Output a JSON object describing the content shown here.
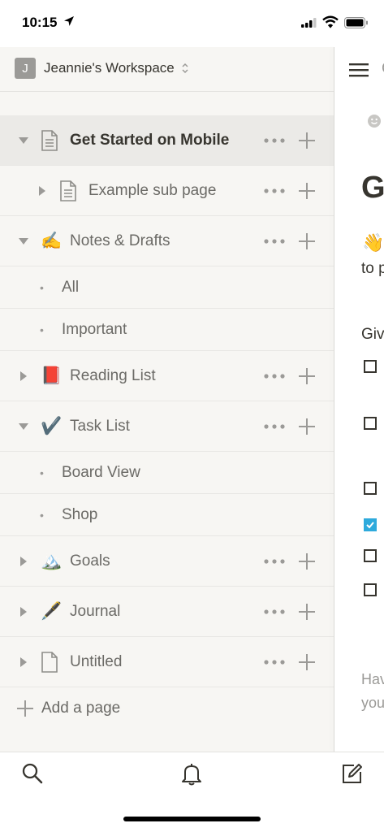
{
  "status_bar": {
    "time": "10:15"
  },
  "workspace": {
    "avatar_letter": "J",
    "name": "Jeannie's Workspace"
  },
  "pages": [
    {
      "type": "page",
      "toggle": "expanded",
      "icon": "page-icon",
      "label": "Get Started on Mobile",
      "active": true
    },
    {
      "type": "subpage",
      "toggle": "collapsed",
      "icon": "page-icon",
      "label": "Example sub page"
    },
    {
      "type": "page",
      "toggle": "expanded",
      "icon": "✍️",
      "label": "Notes & Drafts"
    },
    {
      "type": "view",
      "label": "All"
    },
    {
      "type": "view",
      "label": "Important"
    },
    {
      "type": "page",
      "toggle": "collapsed",
      "icon": "📕",
      "label": "Reading List"
    },
    {
      "type": "page",
      "toggle": "expanded",
      "icon": "✔️",
      "label": "Task List"
    },
    {
      "type": "view",
      "label": "Board View"
    },
    {
      "type": "view",
      "label": "Shop"
    },
    {
      "type": "page",
      "toggle": "collapsed",
      "icon": "🏔️",
      "label": "Goals"
    },
    {
      "type": "page",
      "toggle": "collapsed",
      "icon": "🖋️",
      "label": "Journal"
    },
    {
      "type": "page",
      "toggle": "collapsed",
      "icon": "empty-page-icon",
      "label": "Untitled"
    }
  ],
  "add_page": {
    "label": "Add a page"
  },
  "content_peek": {
    "title_fragment": "G",
    "emoji": "👋",
    "line_fragment": "to p",
    "heading_fragment": "Giv",
    "checkboxes": [
      false,
      false,
      false,
      true,
      false,
      false
    ],
    "footer_line1": "Hav",
    "footer_line2": "you"
  },
  "colors": {
    "sidebar_bg": "#f7f6f3",
    "active_row": "#ebeae7",
    "checkbox_checked": "#2eaadc",
    "text": "#37352f"
  },
  "bottom_tabs": [
    "search-icon",
    "bell-icon",
    "compose-icon"
  ]
}
